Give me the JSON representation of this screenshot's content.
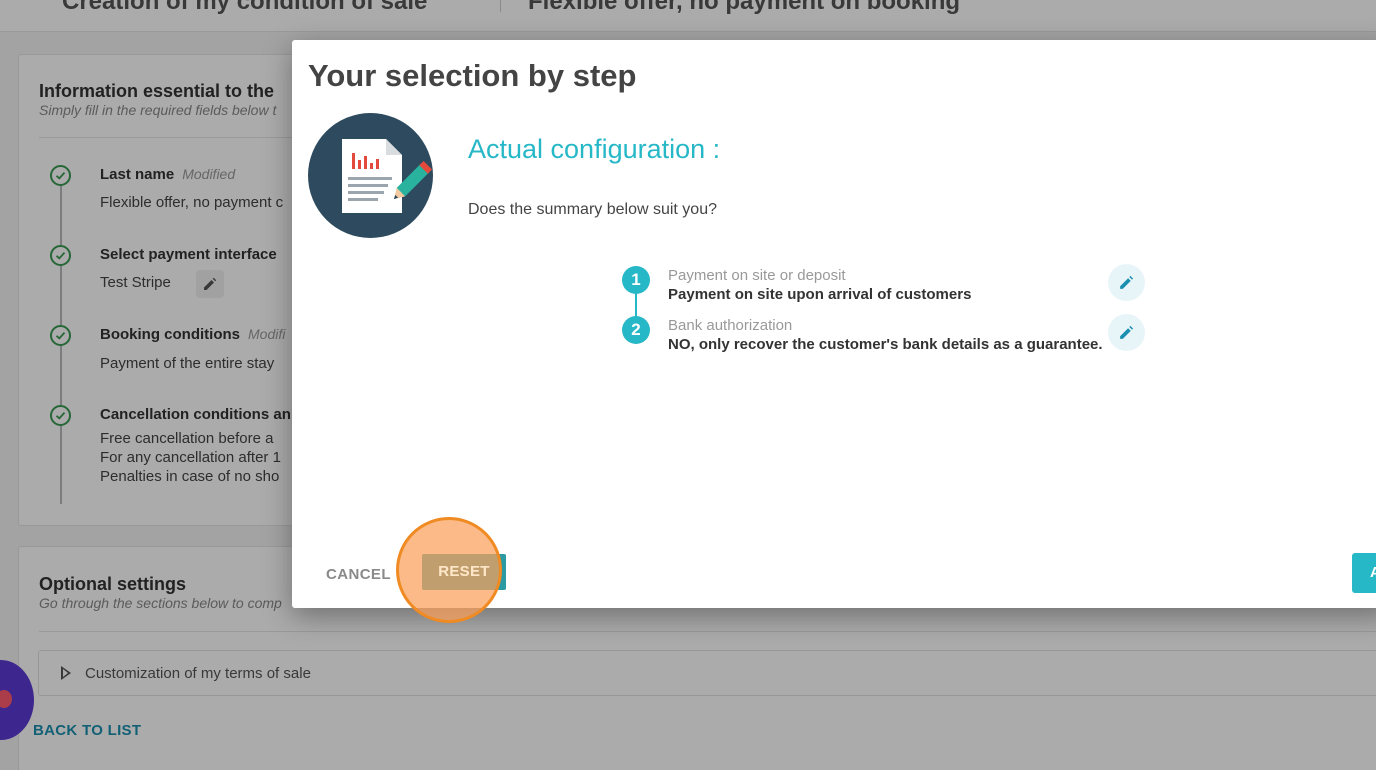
{
  "page": {
    "title": "Creation of my condition of sale",
    "offer_name": "Flexible offer, no payment on booking"
  },
  "info_card": {
    "title": "Information essential to the",
    "subtitle": "Simply fill in the required fields below t",
    "fields": [
      {
        "label": "Last name",
        "modified": "Modified",
        "value": "Flexible offer, no payment c"
      },
      {
        "label": "Select payment interface",
        "modified": "",
        "value": "Test Stripe"
      },
      {
        "label": "Booking conditions",
        "modified": "Modifi",
        "value": "Payment of the entire stay"
      },
      {
        "label": "Cancellation conditions an",
        "modified": "",
        "value_lines": [
          "Free cancellation before a",
          "For any cancellation after 1",
          "Penalties in case of no sho"
        ]
      }
    ]
  },
  "optional_card": {
    "title": "Optional settings",
    "subtitle": "Go through the sections below to comp",
    "accordion_label": "Customization of my terms of sale"
  },
  "back_link": "BACK TO LIST",
  "modal": {
    "title": "Your selection by step",
    "config_title": "Actual configuration :",
    "config_question": "Does the summary below suit you?",
    "steps": [
      {
        "num": "1",
        "caption": "Payment on site or deposit",
        "value": "Payment on site upon arrival of customers"
      },
      {
        "num": "2",
        "caption": "Bank authorization",
        "value": "NO, only recover the customer's bank details as a guarantee."
      }
    ],
    "cancel_label": "CANCEL",
    "reset_label": "RESET",
    "apply_label": "A"
  },
  "colors": {
    "accent": "#27b8c8",
    "check_green": "#3a9a52",
    "link_blue": "#1b8fb0",
    "click_highlight": "#f08a22"
  },
  "icons": [
    "check-circle-icon",
    "pencil-icon",
    "document-chart-icon",
    "chevron-right-icon",
    "chat-icon"
  ]
}
